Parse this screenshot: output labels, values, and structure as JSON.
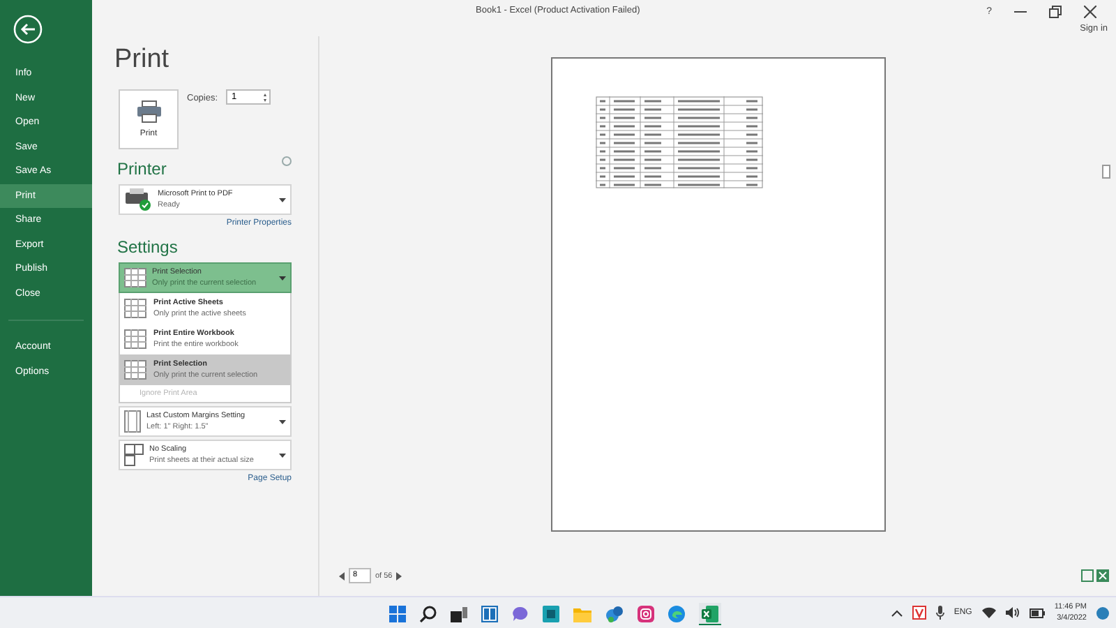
{
  "window": {
    "title": "Book1 - Excel (Product Activation Failed)",
    "help": "?"
  },
  "account": {
    "sign_in": "Sign in"
  },
  "sidebar": {
    "items": [
      {
        "label": "Info",
        "selected": false
      },
      {
        "label": "New",
        "selected": false
      },
      {
        "label": "Open",
        "selected": false
      },
      {
        "label": "Save",
        "selected": false
      },
      {
        "label": "Save As",
        "selected": false
      },
      {
        "label": "Print",
        "selected": true
      },
      {
        "label": "Share",
        "selected": false
      },
      {
        "label": "Export",
        "selected": false
      },
      {
        "label": "Publish",
        "selected": false
      },
      {
        "label": "Close",
        "selected": false
      }
    ],
    "bottom_items": [
      {
        "label": "Account",
        "selected": false
      },
      {
        "label": "Options",
        "selected": false
      }
    ]
  },
  "print": {
    "title": "Print",
    "button": "Print",
    "copies_label": "Copies:",
    "copies": "1"
  },
  "printer": {
    "heading": "Printer",
    "name": "Microsoft Print to PDF",
    "status": "Ready",
    "properties_link": "Printer Properties"
  },
  "settings": {
    "heading": "Settings",
    "current": {
      "title": "Print Selection",
      "subtitle": "Only print the current selection"
    },
    "options": [
      {
        "title": "Print Active Sheets",
        "subtitle": "Only print the active sheets",
        "selected": false
      },
      {
        "title": "Print Entire Workbook",
        "subtitle": "Print the entire workbook",
        "selected": false
      },
      {
        "title": "Print Selection",
        "subtitle": "Only print the current selection",
        "selected": true
      }
    ],
    "ignore_print_area": {
      "label": "Ignore Print Area",
      "disabled": true
    },
    "margins": {
      "title": "Last Custom Margins Setting",
      "subtitle": "Left: 1\"   Right: 1.5\""
    },
    "scaling": {
      "title": "No Scaling",
      "subtitle": "Print sheets at their actual size"
    },
    "page_setup_link": "Page Setup"
  },
  "preview": {
    "page": "8",
    "of": "of 56"
  },
  "taskbar": {
    "language": "ENG",
    "time": "11:46 PM",
    "date": "3/4/2022"
  }
}
